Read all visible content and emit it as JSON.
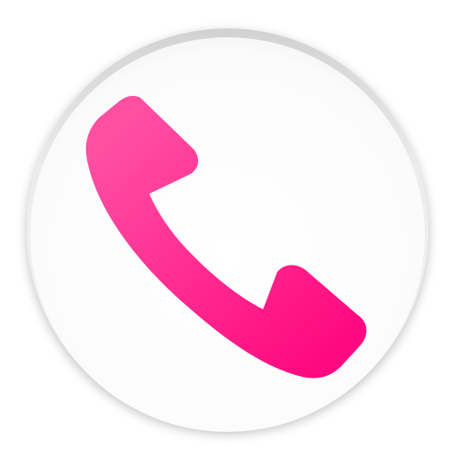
{
  "app_icon": {
    "icon": "phone-handset-icon",
    "background_color": "#ffffff",
    "rim_color": "#c8c8c8",
    "glyph_color_light": "#ff4fa3",
    "glyph_color_dark": "#ff0a80"
  }
}
